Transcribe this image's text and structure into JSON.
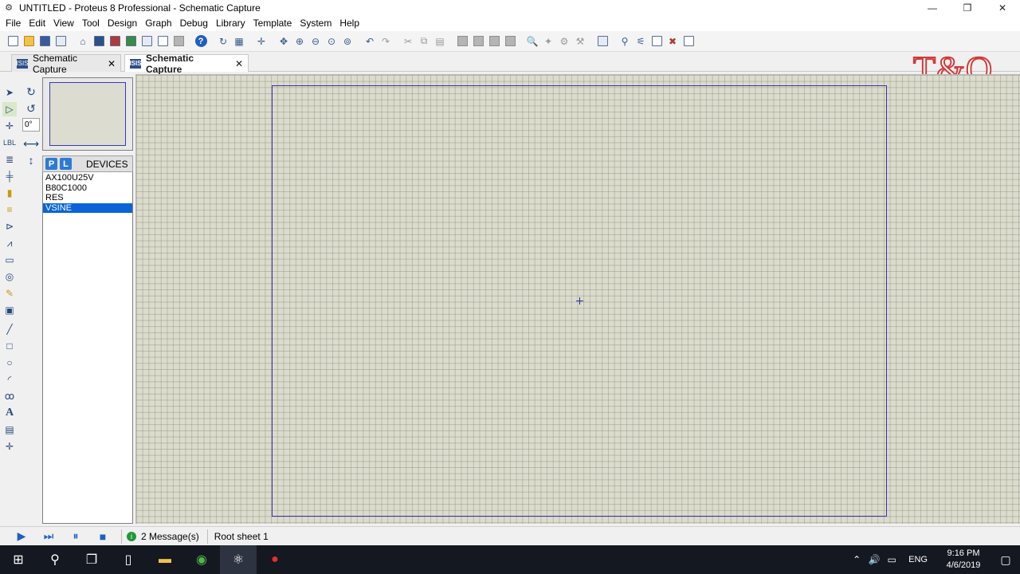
{
  "window": {
    "title": "UNTITLED - Proteus 8 Professional - Schematic Capture",
    "controls": {
      "minimize": "—",
      "restore": "❐",
      "close": "✕"
    }
  },
  "menu": [
    "File",
    "Edit",
    "View",
    "Tool",
    "Design",
    "Graph",
    "Debug",
    "Library",
    "Template",
    "System",
    "Help"
  ],
  "tabs": [
    {
      "label": "Schematic Capture",
      "active": false
    },
    {
      "label": "Schematic Capture",
      "active": true
    }
  ],
  "logo": "T&Q",
  "left_panel": {
    "angle": "0°",
    "picker": {
      "p_label": "P",
      "l_label": "L",
      "header": "DEVICES"
    },
    "devices": [
      "AX100U25V",
      "B80C1000",
      "RES",
      "VSINE"
    ],
    "selected_device": "VSINE"
  },
  "status": {
    "messages": "2 Message(s)",
    "sheet": "Root sheet 1"
  },
  "taskbar": {
    "language": "ENG",
    "time": "9:16 PM",
    "date": "4/6/2019"
  }
}
